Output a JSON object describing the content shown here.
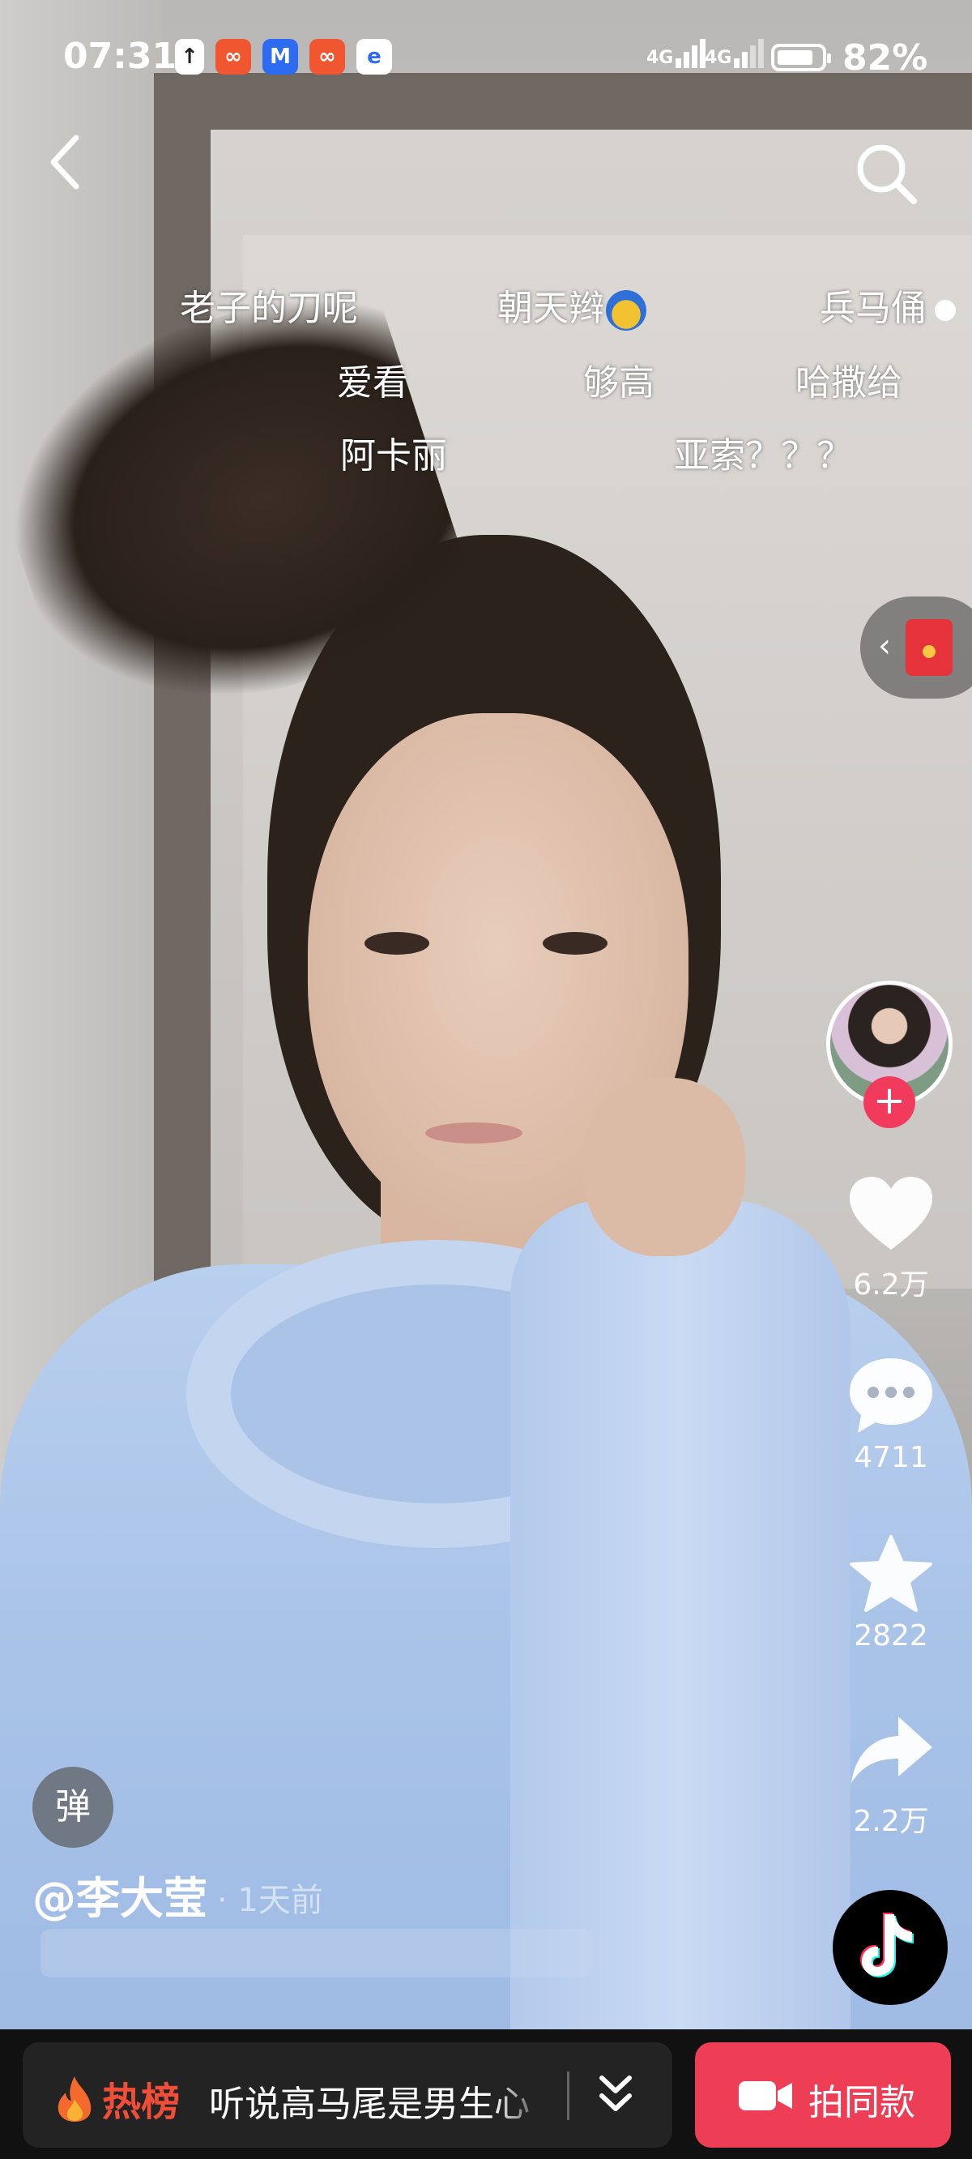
{
  "status_bar": {
    "time": "07:31",
    "network_1": "4G",
    "network_2": "4G",
    "battery_percent": "82%",
    "battery_level": 0.82
  },
  "icons": {
    "back": "chevron-left-icon",
    "search": "search-icon",
    "like": "heart-icon",
    "comment": "comment-icon",
    "favorite": "star-icon",
    "share": "share-icon",
    "red_packet": "red-envelope-icon",
    "camera": "camera-icon"
  },
  "danmaku": [
    "老子的刀呢",
    "朝天辫",
    "兵马俑",
    "爱看",
    "够高",
    "哈撒给",
    "阿卡丽",
    "亚索？？？"
  ],
  "actions": {
    "follow_symbol": "+",
    "likes": "6.2万",
    "comments": "4711",
    "favorites": "2822",
    "shares": "2.2万"
  },
  "post": {
    "danmu_toggle": "弹",
    "author": "@李大莹",
    "time": "· 1天前"
  },
  "bottom_bar": {
    "hot_label": "热榜",
    "hot_text": "听说高马尾是男生心",
    "shoot_same_label": "拍同款"
  },
  "colors": {
    "accent_red": "#EE3E55",
    "hot_orange": "#F04E39",
    "follow_pink": "#F23B5C"
  }
}
